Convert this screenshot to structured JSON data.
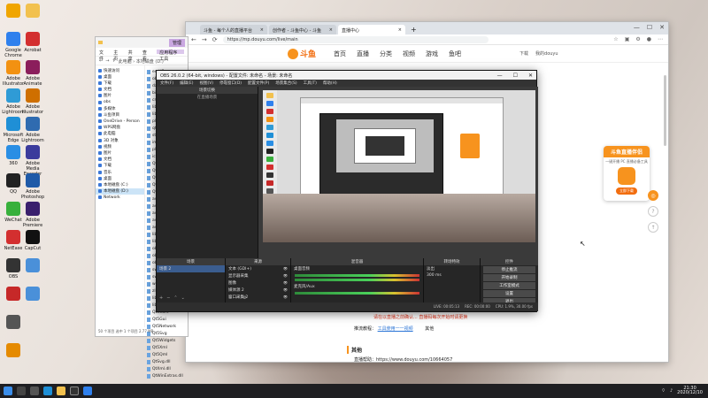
{
  "desktop": {
    "icons": [
      {
        "label": "",
        "color": "#f0a500"
      },
      {
        "label": "Google Chrome",
        "color": "#2f80ed"
      },
      {
        "label": "Adobe Illustrator",
        "color": "#f29111"
      },
      {
        "label": "Adobe Lightroom",
        "color": "#2f9bd6"
      },
      {
        "label": "Microsoft Edge",
        "color": "#1f8fd6"
      },
      {
        "label": "360",
        "color": "#2a8ee4"
      },
      {
        "label": "QQ",
        "color": "#222"
      },
      {
        "label": "WeChat",
        "color": "#38b03c"
      },
      {
        "label": "NetEase",
        "color": "#d32f2f"
      },
      {
        "label": "OBS",
        "color": "#333"
      },
      {
        "label": "",
        "color": "#c62828"
      },
      {
        "label": "",
        "color": "#555"
      },
      {
        "label": "",
        "color": "#e58a00"
      }
    ],
    "icons_col2": [
      {
        "label": "",
        "color": "#f2c14e"
      },
      {
        "label": "Acrobat",
        "color": "#d32f2f"
      },
      {
        "label": "Adobe Animate",
        "color": "#8b1e5c"
      },
      {
        "label": "Adobe Illustrator",
        "color": "#cf6f00"
      },
      {
        "label": "Adobe Lightroom",
        "color": "#2f6bb0"
      },
      {
        "label": "Adobe Media Encoder",
        "color": "#3b3b9c"
      },
      {
        "label": "Adobe Photoshop",
        "color": "#1f5aa8"
      },
      {
        "label": "Adobe Premiere",
        "color": "#3a1f6d"
      },
      {
        "label": "CapCut",
        "color": "#111"
      },
      {
        "label": "",
        "color": "#4a90d9"
      },
      {
        "label": "",
        "color": "#4a90d9"
      }
    ]
  },
  "browser": {
    "tabs": [
      {
        "label": "斗鱼 - 每个人的直播平台",
        "active": false
      },
      {
        "label": "创作者 - 斗鱼中心 - 斗鱼",
        "active": false
      },
      {
        "label": "直播中心",
        "active": true
      }
    ],
    "url": "https://mp.douyu.com/live/main",
    "site_logo": "斗鱼",
    "nav_items": [
      "首页",
      "直播",
      "分类",
      "视频",
      "游戏",
      "鱼吧"
    ],
    "nav_right": [
      "下载",
      "我的douyu"
    ],
    "line_red": "请在以直播之前确认... 直播码每次开始时请更换",
    "tutorial_label": "推流教程：",
    "tutorial_link": "工具使用一一视频",
    "tutorial_extra": "其他",
    "section_title": "其他",
    "help_line": "直播帮助：https://www.douyu.com/10664057",
    "promo_title": "斗鱼直播伴侣",
    "promo_sub": "一键开播 PC 直播必备工具",
    "promo_btn": "立即下载"
  },
  "explorer": {
    "title_tab": "管理",
    "ribbon": [
      "文件",
      "主页",
      "共享",
      "查看",
      "应用程序工具"
    ],
    "addr": "此电脑 › 本地磁盘 (D:)",
    "tree": [
      "快速访问",
      "桌面",
      "下载",
      "文档",
      "图片",
      "obs",
      "多媒体",
      "斗鱼项目",
      "OneDrive - Person",
      "WPS网盘",
      "此电脑",
      "3D 对象",
      "视频",
      "图片",
      "文档",
      "下载",
      "音乐",
      "桌面",
      "本地磁盘 (C:)",
      "本地磁盘 (D:)",
      "Network"
    ],
    "files": [
      "en-US",
      "obs",
      "data",
      "bin",
      "cmake",
      "lib",
      "libobs",
      "plugins",
      "qt",
      "styles",
      "imageformats",
      "platforms",
      "iconengines",
      "QtCore",
      "QtGui",
      "QtNetwork",
      "QtSvg",
      "QtWidgets",
      "avcodec",
      "avdevice",
      "avfilter",
      "avformat",
      "avutil",
      "libcurl",
      "libobs",
      "obs64",
      "obs-frontend",
      "obs-scripting",
      "swresample",
      "swscale",
      "w32-pthreads",
      "zlib",
      "libEGL",
      "libGLESv2",
      "Qt5Core",
      "Qt5Gui",
      "Qt5Network",
      "Qt5Svg",
      "Qt5Widgets",
      "Qt5Xml",
      "Qt5Qml",
      "QtSvg.dll",
      "QtXml.dll",
      "QtWinExtras.dll"
    ],
    "status": "50 个项目    选中 1 个项目 2.77 MB"
  },
  "obs": {
    "title": "OBS 26.0.2 (64-bit, windows) - 配置文件: 未命名 - 场景: 未命名",
    "menu": [
      "文件(F)",
      "编辑(E)",
      "视图(V)",
      "停靠窗口(D)",
      "配置文件(P)",
      "场景集合(S)",
      "工具(T)",
      "帮助(H)"
    ],
    "left_header": "场景切换",
    "left_sub": "在直播场景",
    "docks": {
      "scenes_title": "场景",
      "scenes": [
        "场景 2"
      ],
      "sources_title": "来源",
      "sources": [
        "文本 (GDI+)",
        "显示器采集",
        "图像",
        "媒体源 2",
        "窗口采集 2"
      ],
      "mixer_title": "混音器",
      "mixer": [
        "桌面音频",
        "麦克风/Aux"
      ],
      "trans_title": "转场特效",
      "trans": [
        "淡出",
        "300 ms"
      ],
      "controls_title": "控件",
      "controls": [
        "停止推流",
        "开始录制",
        "工作室模式",
        "设置",
        "退出"
      ]
    },
    "status": [
      "LIVE: 00:05:13",
      "REC: 00:00:00",
      "CPU: 1.9%, 30.00 fps"
    ]
  },
  "taskbar": {
    "time": "21:30",
    "date": "2020/12/10"
  }
}
